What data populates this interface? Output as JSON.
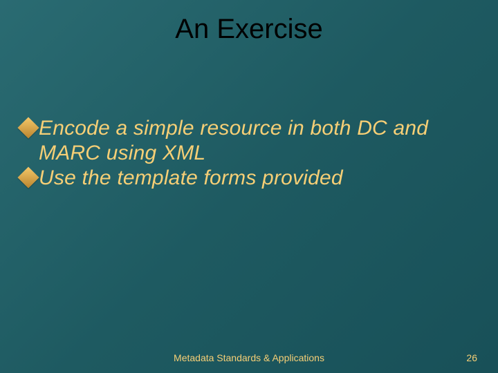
{
  "slide": {
    "title": "An Exercise",
    "bullets": [
      {
        "text": "Encode a simple resource in both DC and MARC using XML"
      },
      {
        "text": "Use the template forms provided"
      }
    ],
    "footer": "Metadata Standards & Applications",
    "page_number": "26"
  }
}
